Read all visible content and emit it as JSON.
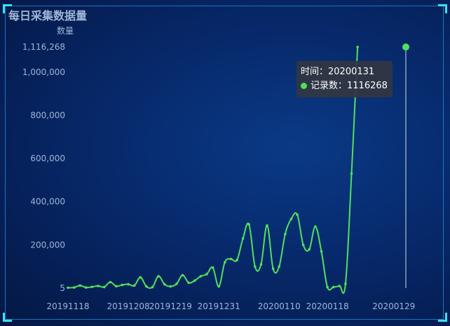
{
  "title": "每日采集数据量",
  "colors": {
    "line": "#52e05c",
    "axis_text": "#9fb6d6",
    "cursor": "#cfd8e6",
    "tooltip_bg": "#323742"
  },
  "tooltip": {
    "time_label": "时间：",
    "time_value": "20200131",
    "series_label": "记录数：",
    "series_value": "1116268"
  },
  "chart_data": {
    "type": "line",
    "xlabel": "",
    "ylabel": "数量",
    "ylim": [
      5,
      1116268
    ],
    "y_ticks": [
      "5",
      "200,000",
      "400,000",
      "600,000",
      "800,000",
      "1,000,000",
      "1,116,268"
    ],
    "x_tick_labels": [
      "20191118",
      "20191208",
      "20191219",
      "20191231",
      "20200110",
      "20200118",
      "20200129"
    ],
    "x": [
      "20191118",
      "20191120",
      "20191122",
      "20191124",
      "20191126",
      "20191128",
      "20191130",
      "20191202",
      "20191204",
      "20191206",
      "20191208",
      "20191210",
      "20191212",
      "20191214",
      "20191216",
      "20191217",
      "20191218",
      "20191219",
      "20191220",
      "20191221",
      "20191222",
      "20191224",
      "20191226",
      "20191228",
      "20191230",
      "20191231",
      "20200101",
      "20200102",
      "20200103",
      "20200104",
      "20200105",
      "20200106",
      "20200107",
      "20200108",
      "20200109",
      "20200110",
      "20200111",
      "20200112",
      "20200113",
      "20200114",
      "20200115",
      "20200116",
      "20200117",
      "20200118",
      "20200119",
      "20200120",
      "20200121",
      "20200122",
      "20200123",
      "20200124",
      "20200125",
      "20200126",
      "20200127",
      "20200128",
      "20200129",
      "20200130",
      "20200131"
    ],
    "series": [
      {
        "values": [
          2000,
          3000,
          12000,
          3000,
          6000,
          10000,
          5000,
          28000,
          9000,
          15000,
          18000,
          12000,
          50000,
          8000,
          5000,
          55000,
          18000,
          8000,
          20000,
          60000,
          25000,
          35000,
          55000,
          65000,
          95000,
          8000,
          120000,
          135000,
          130000,
          230000,
          295000,
          100000,
          110000,
          290000,
          90000,
          100000,
          250000,
          320000,
          340000,
          200000,
          180000,
          285000,
          170000,
          5000,
          5000,
          10000,
          20000,
          530000,
          1116268
        ]
      }
    ],
    "highlight": {
      "x": "20200131",
      "value": 1116268
    }
  }
}
